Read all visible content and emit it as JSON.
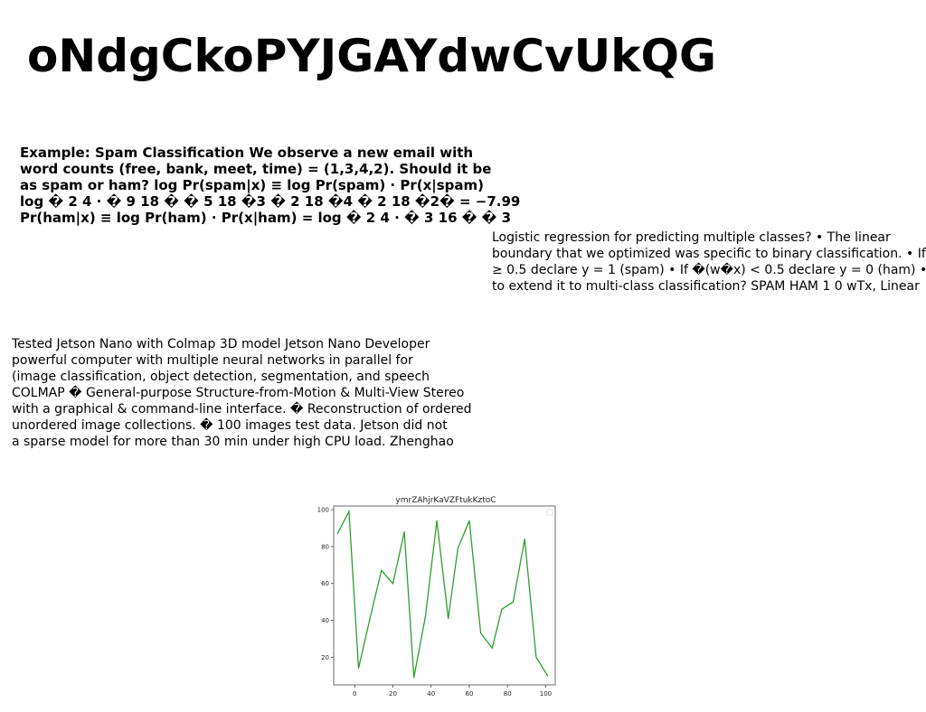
{
  "title": "oNdgCkoPYJGAYdwCvUkQG",
  "block_a": {
    "lines": [
      "Example: Spam Classification We observe a new email with",
      "word counts (free, bank, meet, time) = (1,3,4,2). Should it be",
      "as spam or ham? log Pr(spam|x) ≡ log Pr(spam) · Pr(x|spam)",
      "log � 2 4 · � 9 18 � � 5 18 �3 � 2 18 �4 � 2 18 �2� = −7.99",
      "Pr(ham|x) ≡ log Pr(ham) · Pr(x|ham) = log � 2 4 · � 3 16 � � 3"
    ]
  },
  "block_b": {
    "lines": [
      "Logistic regression for predicting multiple classes? • The linear",
      "boundary that we optimized was specific to binary classification. • If",
      "≥ 0.5 declare y = 1 (spam) • If �(w�x) < 0.5 declare y = 0 (ham) •",
      "to extend it to multi-class classification? SPAM HAM 1 0 wTx, Linear"
    ]
  },
  "block_c": {
    "lines": [
      "Tested Jetson Nano with Colmap 3D model Jetson Nano Developer",
      "powerful computer with multiple neural networks in parallel for",
      "(image classification, object detection, segmentation, and speech",
      "COLMAP � General-purpose Structure-from-Motion & Multi-View Stereo",
      "with a graphical & command-line interface. � Reconstruction of ordered",
      "unordered image collections. � 100 images test data. Jetson did not",
      "a sparse model for more than 30 min under high CPU load. Zhenghao"
    ]
  },
  "chart_data": {
    "type": "line",
    "title": "ymrZAhjrKaVZFtukKztoC",
    "xlabel": "",
    "ylabel": "",
    "xlim": [
      -11,
      105
    ],
    "ylim": [
      5,
      102
    ],
    "xticks": [
      0,
      20,
      40,
      60,
      80,
      100
    ],
    "yticks": [
      20,
      40,
      60,
      80,
      100
    ],
    "grid": false,
    "legend": "top-right",
    "series": [
      {
        "color": "#2ca02c",
        "x": [
          -9,
          -3,
          2,
          8,
          14,
          20,
          26,
          31,
          37,
          43,
          49,
          54,
          60,
          66,
          72,
          77,
          83,
          89,
          95,
          101
        ],
        "y": [
          87,
          99,
          14,
          41,
          67,
          60,
          88,
          9,
          42,
          94,
          41,
          79,
          94,
          33,
          25,
          46,
          50,
          84,
          20,
          10
        ]
      }
    ]
  }
}
